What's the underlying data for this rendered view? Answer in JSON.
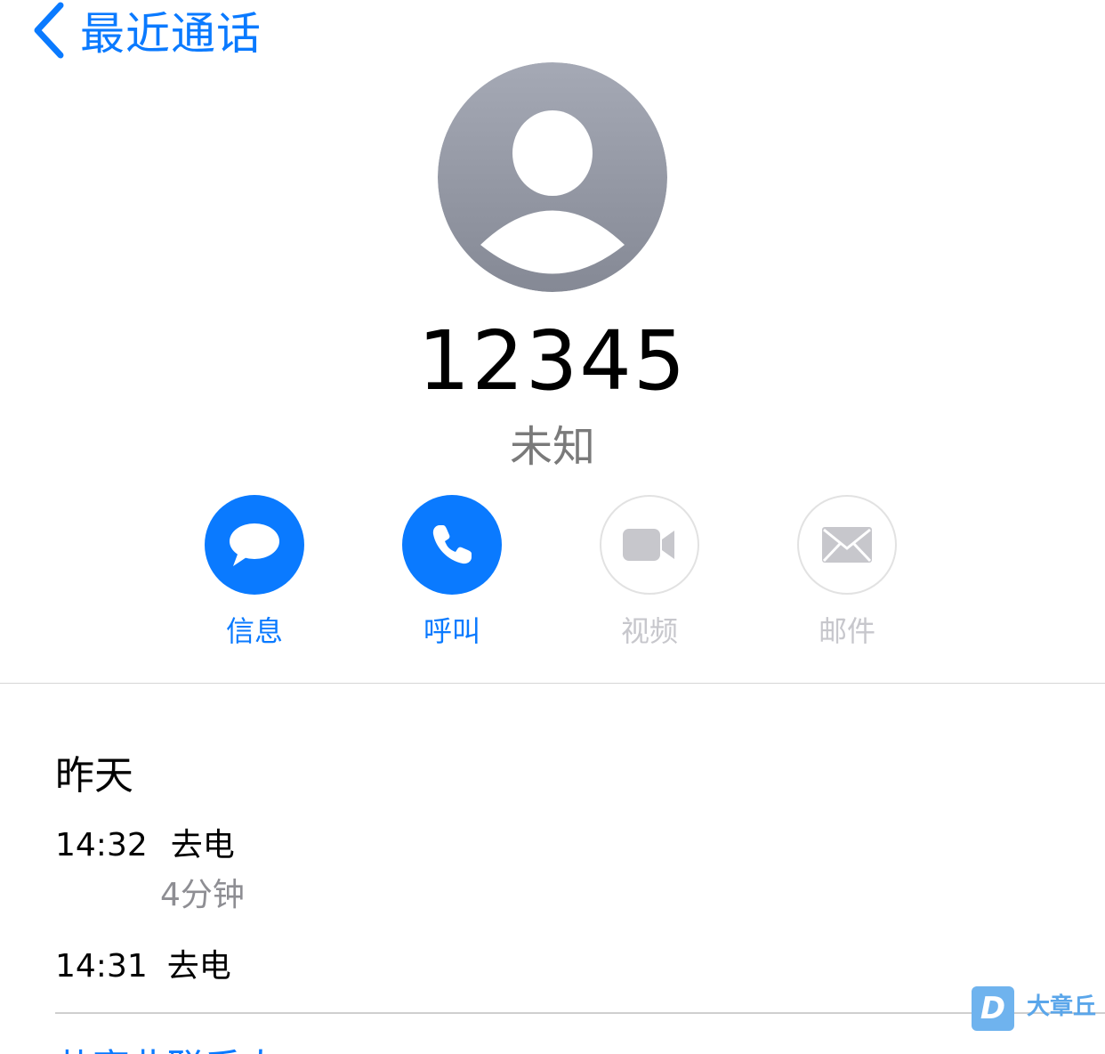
{
  "nav": {
    "back_label": "最近通话"
  },
  "contact": {
    "number": "12345",
    "label": "未知"
  },
  "actions": [
    {
      "label": "信息",
      "icon": "message-bubble-icon",
      "enabled": true
    },
    {
      "label": "呼叫",
      "icon": "phone-icon",
      "enabled": true
    },
    {
      "label": "视频",
      "icon": "video-camera-icon",
      "enabled": false
    },
    {
      "label": "邮件",
      "icon": "envelope-icon",
      "enabled": false
    }
  ],
  "history": {
    "date": "昨天",
    "calls": [
      {
        "time": "14:32",
        "type": "去电",
        "duration": "4分钟"
      },
      {
        "time": "14:31",
        "type": "去电"
      }
    ]
  },
  "bottom": {
    "link_text": "共享此联系人"
  },
  "watermark": {
    "logo": "D",
    "text": "大章丘"
  },
  "colors": {
    "accent": "#0a7aff",
    "disabled": "#c7c7cc",
    "secondary_text": "#8e8e93"
  }
}
